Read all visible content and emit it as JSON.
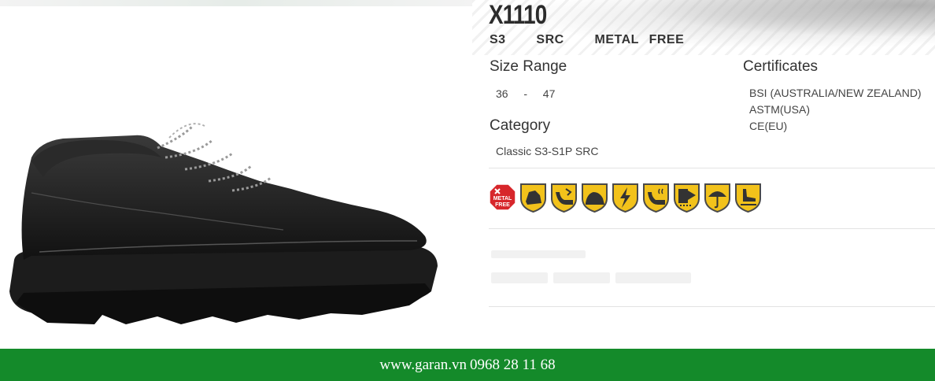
{
  "product": {
    "model": "X1110",
    "spec_line": "S3   SRC   METAL FREE"
  },
  "size_range": {
    "title": "Size Range",
    "value": "36  -  47"
  },
  "category": {
    "title": "Category",
    "value": "Classic S3-S1P SRC"
  },
  "certificates": {
    "title": "Certificates",
    "items": [
      "BSI (AUSTRALIA/NEW ZEALAND)",
      "ASTM(USA)",
      "CE(EU)"
    ]
  },
  "feature_icons": {
    "metal_free_badge": {
      "text_top": "METAL",
      "text_bottom": "FREE",
      "color": "#d7262b"
    },
    "shield_color": "#f2c21b",
    "shield_border": "#4a4a4a",
    "shields": [
      "toe-cap-icon",
      "heel-energy-icon",
      "sole-icon",
      "antistatic-icon",
      "oil-resistant-icon",
      "penetration-icon",
      "water-resistant-icon",
      "slip-resistant-icon"
    ]
  },
  "footer": {
    "website": "www.garan.vn",
    "phone": "0968 28 11 68",
    "color": "#148a2a"
  }
}
